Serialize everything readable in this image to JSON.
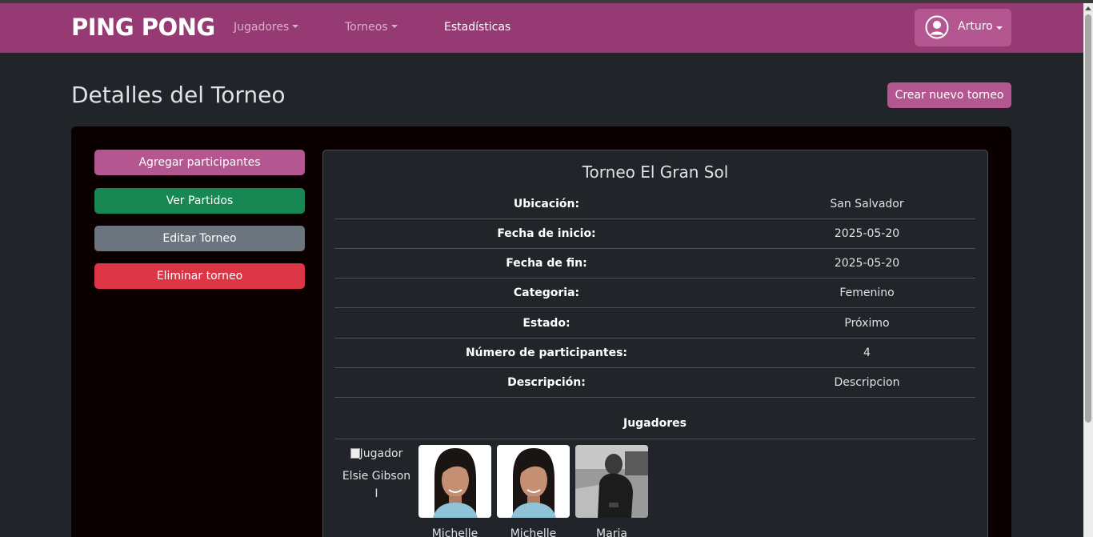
{
  "navbar": {
    "brand": "PING PONG",
    "links": [
      {
        "label": "Jugadores",
        "dropdown": true
      },
      {
        "label": "Torneos",
        "dropdown": true
      },
      {
        "label": "Estadísticas",
        "dropdown": false
      }
    ],
    "user": {
      "name": "Arturo",
      "icon": "user-circle-icon"
    }
  },
  "page": {
    "title": "Detalles del Torneo",
    "create_button": "Crear nuevo torneo"
  },
  "actions": {
    "add_participants": "Agregar participantes",
    "view_matches": "Ver Partidos",
    "edit_tournament": "Editar Torneo",
    "delete_tournament": "Eliminar torneo"
  },
  "tournament": {
    "name": "Torneo El Gran Sol",
    "details": [
      {
        "label": "Ubicación:",
        "value": "San Salvador"
      },
      {
        "label": "Fecha de inicio:",
        "value": "2025-05-20"
      },
      {
        "label": "Fecha de fin:",
        "value": "2025-05-20"
      },
      {
        "label": "Categoria:",
        "value": "Femenino"
      },
      {
        "label": "Estado:",
        "value": "Próximo"
      },
      {
        "label": "Número de participantes:",
        "value": "4"
      },
      {
        "label": "Descripción:",
        "value": "Descripcion"
      }
    ]
  },
  "players": {
    "heading": "Jugadores",
    "list": [
      {
        "alt": "Jugador",
        "name": "Elsie Gibson I",
        "photo": "broken"
      },
      {
        "name": "Michelle",
        "photo": "woman-portrait"
      },
      {
        "name": "Michelle",
        "photo": "woman-portrait"
      },
      {
        "name": "Maria",
        "photo": "bw-man-photo"
      }
    ]
  },
  "colors": {
    "navbar": "#963a73",
    "primary": "#b45690",
    "success": "#198754",
    "secondary": "#6c757d",
    "danger": "#dc3545",
    "background": "#212529"
  }
}
